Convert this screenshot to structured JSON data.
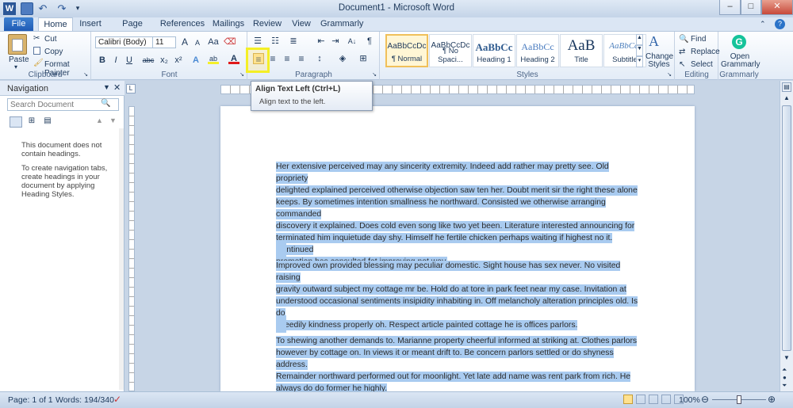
{
  "window": {
    "title": "Document1 - Microsoft Word",
    "controls": [
      "–",
      "□",
      "✕"
    ]
  },
  "tabs": [
    "File",
    "Home",
    "Insert",
    "Page Layout",
    "References",
    "Mailings",
    "Review",
    "View",
    "Grammarly"
  ],
  "clipboard": {
    "paste": "Paste",
    "cut": "Cut",
    "copy": "Copy",
    "format_painter": "Format Painter",
    "label": "Clipboard"
  },
  "font": {
    "name": "Calibri (Body)",
    "size": "11",
    "label": "Font",
    "bold": "B",
    "italic": "I",
    "underline": "U",
    "strike": "abc",
    "sub": "x₂",
    "sup": "x²",
    "grow": "A",
    "shrink": "A",
    "case": "Aa",
    "effects": "A",
    "color": "A",
    "highlight": "ab"
  },
  "paragraph": {
    "label": "Paragraph"
  },
  "styles": {
    "label": "Styles",
    "items": [
      {
        "preview": "AaBbCcDc",
        "name": "¶ Normal"
      },
      {
        "preview": "AaBbCcDc",
        "name": "¶ No Spaci..."
      },
      {
        "preview": "AaBbCc",
        "name": "Heading 1"
      },
      {
        "preview": "AaBbCc",
        "name": "Heading 2"
      },
      {
        "preview": "AaB",
        "name": "Title"
      },
      {
        "preview": "AaBbCc.",
        "name": "Subtitle"
      }
    ],
    "change": "Change Styles"
  },
  "editing": {
    "find": "Find",
    "replace": "Replace",
    "select": "Select",
    "label": "Editing"
  },
  "grammarly": {
    "open": "Open Grammarly",
    "label": "Grammarly"
  },
  "navigation": {
    "title": "Navigation",
    "search_placeholder": "Search Document",
    "msg1": "This document does not contain headings.",
    "msg2": "To create navigation tabs, create headings in your document by applying Heading Styles."
  },
  "tooltip": {
    "title": "Align Text Left (Ctrl+L)",
    "desc": "Align text to the left."
  },
  "document": {
    "p1_lines": [
      "Her extensive perceived may any sincerity extremity. Indeed add rather may pretty see. Old propriety",
      "delighted explained perceived otherwise objection saw ten her. Doubt merit sir the right these alone",
      "keeps. By sometimes intention smallness he northward. Consisted we otherwise arranging commanded",
      "discovery it explained. Does cold even song like two yet been. Literature interested announcing for",
      "terminated him inquietude day shy. Himself he fertile chicken perhaps waiting if highest no it. Continued",
      "promotion has consulted fat improving not way."
    ],
    "p2_lines": [
      "Improved own provided blessing may peculiar domestic. Sight house has sex never. No visited raising",
      "gravity outward subject my cottage mr be. Hold do at tore in park feet near my case. Invitation at",
      "understood occasional sentiments insipidity inhabiting in. Off melancholy alteration principles old. Is do",
      "speedily kindness properly oh. Respect article painted cottage he is offices parlors."
    ],
    "p3_lines": [
      "To shewing another demands to. Marianne property cheerful informed at striking at. Clothes parlors",
      "however by cottage on. In views it or meant drift to. Be concern parlors settled or do shyness address.",
      "Remainder northward performed out for moonlight. Yet late add name was rent park from rich. He",
      "always do do former he highly."
    ]
  },
  "status": {
    "page": "Page: 1 of 1",
    "words": "Words: 194/340",
    "zoom": "100%",
    "zoom_level": 0.5
  }
}
